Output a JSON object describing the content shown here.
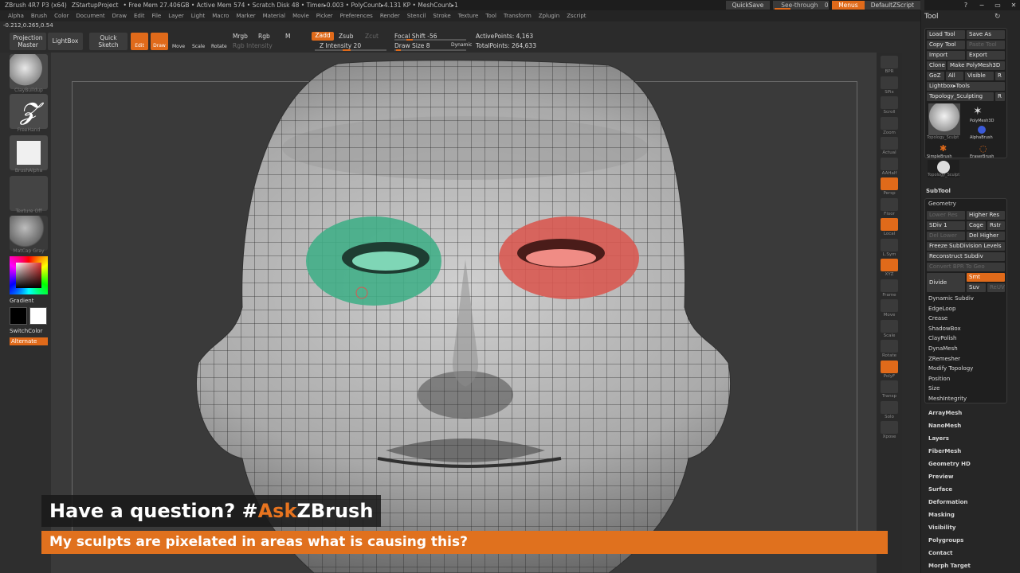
{
  "app": {
    "title": "ZBrush 4R7 P3 (x64)",
    "project": "ZStartupProject",
    "stats": "• Free Mem 27.406GB • Active Mem 574 • Scratch Disk 48 • Timer▸0.003 • PolyCount▸4.131 KP • MeshCount▸1",
    "quicksave": "QuickSave",
    "seethrough": "See-through",
    "seethrough_value": "0",
    "menus": "Menus",
    "script": "DefaultZScript"
  },
  "menubar": [
    "Alpha",
    "Brush",
    "Color",
    "Document",
    "Draw",
    "Edit",
    "File",
    "Layer",
    "Light",
    "Macro",
    "Marker",
    "Material",
    "Movie",
    "Picker",
    "Preferences",
    "Render",
    "Stencil",
    "Stroke",
    "Texture",
    "Tool",
    "Transform",
    "Zplugin",
    "Zscript"
  ],
  "coords": "-0.212,0.265,0.54",
  "toolbar": {
    "projection_master": "Projection Master",
    "lightbox": "LightBox",
    "quick_sketch": "Quick Sketch",
    "edit": "Edit",
    "draw": "Draw",
    "move": "Move",
    "scale": "Scale",
    "rotate": "Rotate",
    "mrgb": "Mrgb",
    "rgb": "Rgb",
    "m": "M",
    "rgb_intensity": "Rgb Intensity",
    "zadd": "Zadd",
    "zsub": "Zsub",
    "zcut": "Zcut",
    "z_intensity": "Z Intensity 20",
    "focal_shift": "Focal Shift -56",
    "draw_size": "Draw Size 8",
    "dynamic": "Dynamic",
    "active_points": "ActivePoints: 4,163",
    "total_points": "TotalPoints: 264,633"
  },
  "left_shelf": {
    "brush_label": "ClayBuildup",
    "stroke_label": "FreeHand",
    "alpha_label": "BrushAlpha",
    "texture_label": "Texture Off",
    "material_label": "MatCap Gray",
    "gradient": "Gradient",
    "switch_color": "SwitchColor",
    "alternate": "Alternate"
  },
  "right_shelf": [
    "BPR",
    "SPix",
    "Scroll",
    "Zoom",
    "Actual",
    "AAHalf",
    "Persp",
    "Floor",
    "Local",
    "L.Sym",
    "XYZ",
    "Frame",
    "Move",
    "Scale",
    "Rotate",
    "PolyF",
    "Transp",
    "Solo",
    "Xpose"
  ],
  "palette": {
    "title": "Tool",
    "row1": [
      "Load Tool",
      "Save As"
    ],
    "row2": [
      "Copy Tool",
      "Paste Tool"
    ],
    "row3": [
      "Import",
      "Export"
    ],
    "row4": [
      "Clone",
      "Make PolyMesh3D"
    ],
    "row5": [
      "GoZ",
      "All",
      "Visible",
      "R"
    ],
    "lightbox_tools": "Lightbox▸Tools",
    "current_tool": "Topology_Sculpting",
    "current_tool_r": "R",
    "thumbs": [
      "Topology_Sculpt",
      "PolyMesh3D",
      "AlphaBrush",
      "SimpleBrush",
      "EraserBrush",
      "Topology_Sculpt"
    ],
    "subtool": "SubTool",
    "geometry": "Geometry",
    "geo_rows": [
      [
        "Lower Res",
        "Higher Res"
      ],
      [
        "SDiv 1",
        "Cage",
        "Rstr"
      ],
      [
        "Del Lower",
        "Del Higher"
      ]
    ],
    "freeze": "Freeze SubDivision Levels",
    "reconstruct": "Reconstruct Subdiv",
    "convert_bpr": "Convert BPR To Geo",
    "divide": "Divide",
    "smt": "Smt",
    "suv": "Suv",
    "reuv": "ReUV",
    "geo_items": [
      "Dynamic Subdiv",
      "EdgeLoop",
      "Crease",
      "ShadowBox",
      "ClayPolish",
      "DynaMesh",
      "ZRemesher",
      "Modify Topology",
      "Position",
      "Size",
      "MeshIntegrity"
    ],
    "sections": [
      "ArrayMesh",
      "NanoMesh",
      "Layers",
      "FiberMesh",
      "Geometry HD",
      "Preview",
      "Surface",
      "Deformation",
      "Masking",
      "Visibility",
      "Polygroups",
      "Contact",
      "Morph Target"
    ]
  },
  "overlay": {
    "question_prefix": "Have a question? #",
    "question_accent": "Ask",
    "question_suffix": "ZBrush",
    "subtitle": "My sculpts are pixelated in areas what is causing this?"
  },
  "colors": {
    "accent": "#e06a1a",
    "mask_green": "#3fae86",
    "mask_red": "#d9564f",
    "banner_orange": "#e0711e"
  }
}
